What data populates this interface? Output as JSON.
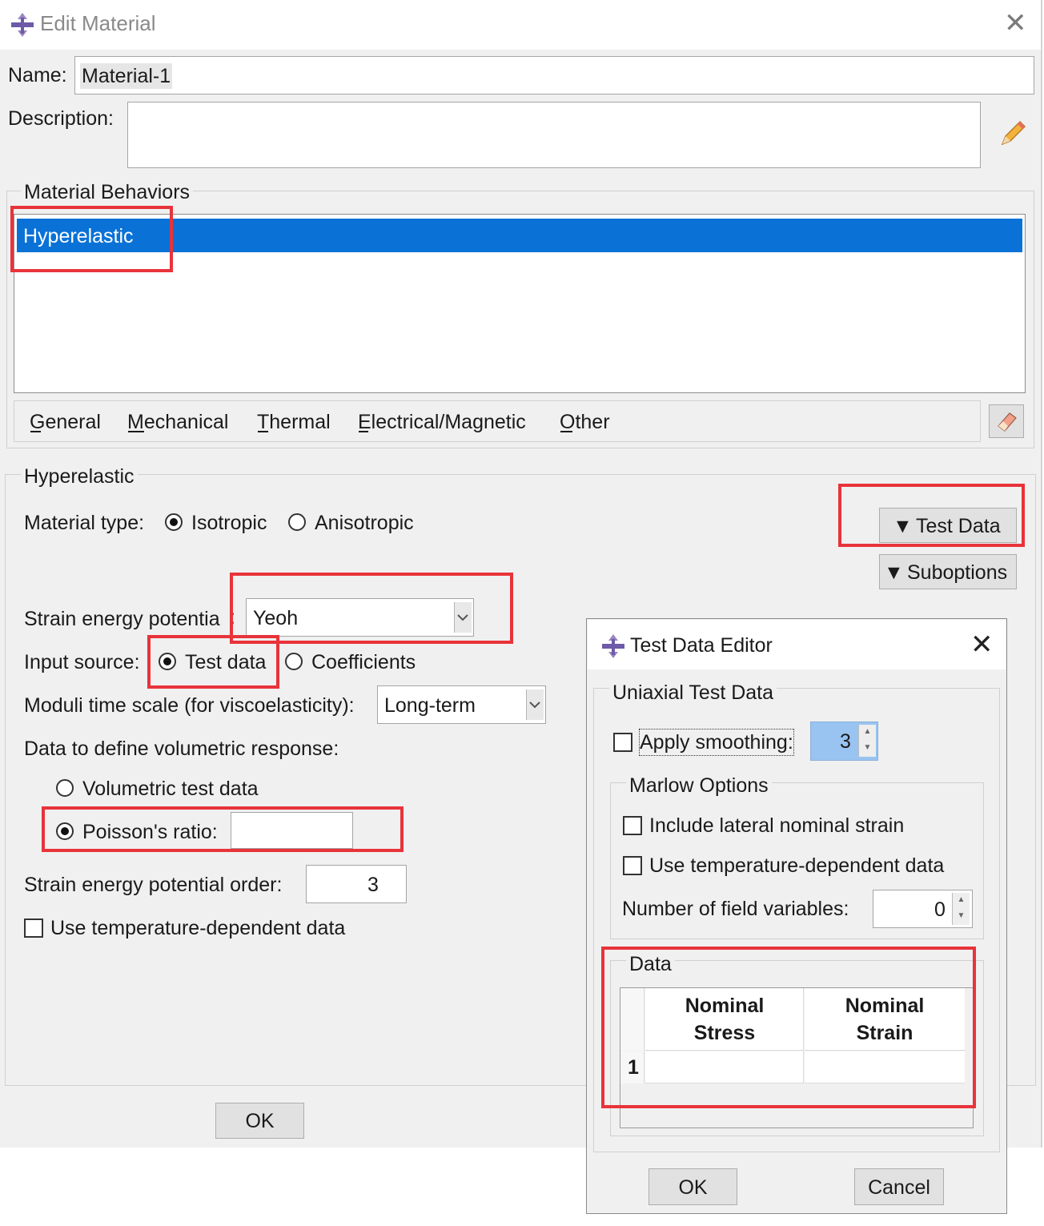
{
  "window": {
    "title": "Edit Material",
    "icon": "abaqus-logo-icon",
    "close_icon": "close-icon"
  },
  "name": {
    "label": "Name:",
    "value": "Material-1"
  },
  "description": {
    "label": "Description:",
    "value": "",
    "edit_icon": "pencil-icon"
  },
  "behaviors": {
    "group_title": "Material Behaviors",
    "items": [
      "Hyperelastic"
    ],
    "selected": "Hyperelastic",
    "menu": [
      "General",
      "Mechanical",
      "Thermal",
      "Electrical/Magnetic",
      "Other"
    ],
    "delete_icon": "eraser-icon"
  },
  "hyperelastic": {
    "group_title": "Hyperelastic",
    "material_type_label": "Material type:",
    "material_type_options": [
      "Isotropic",
      "Anisotropic"
    ],
    "material_type_selected": "Isotropic",
    "test_data_button": "Test Data",
    "suboptions_button": "Suboptions",
    "strain_energy_label": "Strain energy potentia",
    "strain_energy_value": "Yeoh",
    "input_source_label": "Input source:",
    "input_source_options": [
      "Test data",
      "Coefficients"
    ],
    "input_source_selected": "Test data",
    "moduli_label": "Moduli time scale (for viscoelasticity):",
    "moduli_value": "Long-term",
    "volumetric_label": "Data to define volumetric response:",
    "volumetric_options": [
      "Volumetric test data",
      "Poisson's ratio:"
    ],
    "volumetric_selected": "Poisson's ratio:",
    "poisson_value": "",
    "order_label": "Strain energy potential order:",
    "order_value": "3",
    "temp_dependent_label": "Use temperature-dependent data",
    "temp_dependent_checked": false
  },
  "buttons": {
    "ok": "OK"
  },
  "test_data_editor": {
    "title": "Test Data Editor",
    "icon": "abaqus-logo-icon",
    "close_icon": "close-icon",
    "uniaxial_title": "Uniaxial Test Data",
    "apply_smoothing_label": "Apply smoothing:",
    "apply_smoothing_checked": false,
    "smoothing_value": "3",
    "marlow_title": "Marlow Options",
    "include_lateral_label": "Include lateral nominal strain",
    "include_lateral_checked": false,
    "use_temp_label": "Use temperature-dependent data",
    "use_temp_checked": false,
    "field_vars_label": "Number of field variables:",
    "field_vars_value": "0",
    "data_title": "Data",
    "columns": [
      {
        "line1": "Nominal",
        "line2": "Stress"
      },
      {
        "line1": "Nominal",
        "line2": "Strain"
      }
    ],
    "rows": [
      {
        "index": "1",
        "stress": "",
        "strain": ""
      }
    ],
    "ok": "OK",
    "cancel": "Cancel"
  },
  "colors": {
    "selection": "#0a72d6",
    "highlight_box": "#e8333a",
    "spin_selected": "#99c4f1"
  }
}
